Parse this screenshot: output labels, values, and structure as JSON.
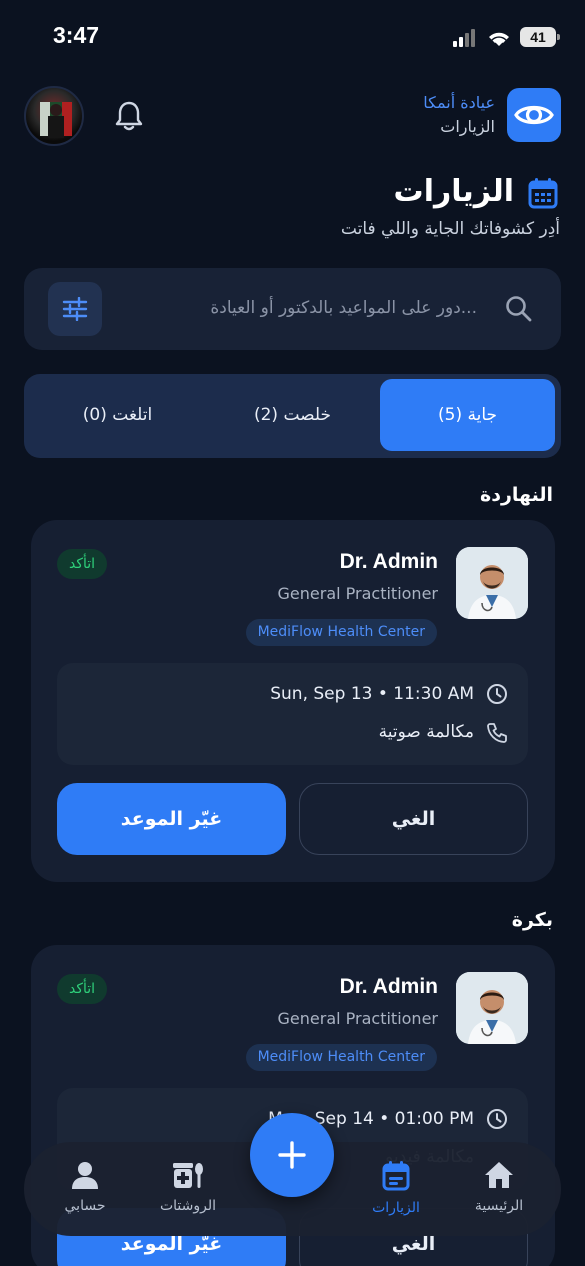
{
  "status_bar": {
    "time": "3:47",
    "battery": "41"
  },
  "header": {
    "app_name": "عيادة أنمكا",
    "app_sub": "الزيارات"
  },
  "page": {
    "title": "الزيارات",
    "subtitle": "أدِر كشوفاتك الجاية واللي فاتت"
  },
  "search": {
    "placeholder": "دور على المواعيد بالدكتور أو العيادة..."
  },
  "tabs": [
    {
      "label": "جاية (5)",
      "active": true
    },
    {
      "label": "خلصت (2)",
      "active": false
    },
    {
      "label": "اتلغت (0)",
      "active": false
    }
  ],
  "sections": [
    {
      "heading": "النهاردة",
      "card": {
        "doctor": "Dr. Admin",
        "specialty": "General Practitioner",
        "clinic": "MediFlow Health Center",
        "status": "اتأكد",
        "datetime": "Sun, Sep 13 • 11:30 AM",
        "type": "مكالمة صوتية",
        "reschedule": "غيّر الموعد",
        "cancel": "الغي"
      }
    },
    {
      "heading": "بكرة",
      "card": {
        "doctor": "Dr. Admin",
        "specialty": "General Practitioner",
        "clinic": "MediFlow Health Center",
        "status": "اتأكد",
        "datetime": "Mon, Sep 14 • 01:00 PM",
        "type": "مكالمة فيديو",
        "reschedule": "غيّر الموعد",
        "cancel": "الغي"
      }
    }
  ],
  "nav": [
    {
      "label": "الرئيسية",
      "icon": "home-icon",
      "active": false
    },
    {
      "label": "الزيارات",
      "icon": "calendar-icon",
      "active": true
    },
    {
      "label": "الروشتات",
      "icon": "prescription-icon",
      "active": false
    },
    {
      "label": "حسابي",
      "icon": "user-icon",
      "active": false
    }
  ],
  "colors": {
    "accent": "#2f7cf6",
    "background": "#0b1220",
    "card": "#161f32",
    "success": "#2ecf7a"
  }
}
